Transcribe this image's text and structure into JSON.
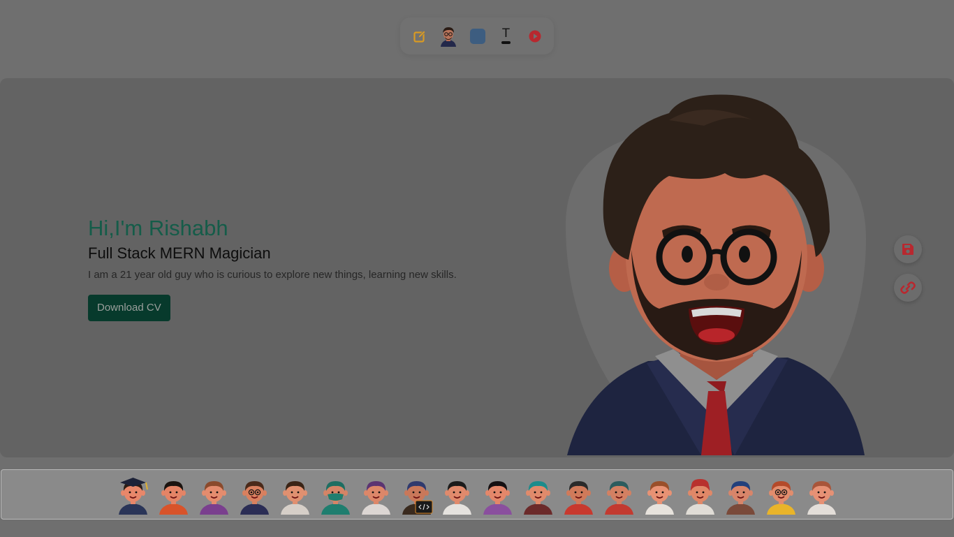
{
  "toolbar": {
    "items": [
      "edit-icon",
      "avatar-thumb",
      "color-swatch",
      "text-style",
      "play-icon"
    ],
    "text_glyph": "T",
    "swatch_color": "#3d5d80",
    "edit_color": "#d99a22",
    "play_color": "#b8282f"
  },
  "hero": {
    "greeting": "Hi,I'm Rishabh",
    "role": "Full Stack MERN Magician",
    "bio": "I am a 21 year old guy who is curious to explore new things, learning new skills.",
    "download_label": "Download CV",
    "accent_color": "#155c49",
    "button_color": "#073a2c"
  },
  "side_actions": [
    "save-icon",
    "link-icon"
  ],
  "avatar_strip": {
    "avatars": [
      {
        "name": "graduate",
        "skin": "#e8876a",
        "hair": "#2b1d15",
        "shirt": "#2a3558",
        "hat": "grad"
      },
      {
        "name": "girl-black-hair",
        "skin": "#e48466",
        "hair": "#1b1410",
        "shirt": "#d8532a"
      },
      {
        "name": "girl-brown-hair",
        "skin": "#e48c6e",
        "hair": "#8a4a2c",
        "shirt": "#7a3f8e"
      },
      {
        "name": "man-glasses-suit",
        "skin": "#d9805f",
        "hair": "#4a2a1a",
        "shirt": "#2b2d55",
        "glasses": true
      },
      {
        "name": "man-painter",
        "skin": "#e09070",
        "hair": "#3a2416",
        "shirt": "#d6cfc8"
      },
      {
        "name": "surgeon",
        "skin": "#d58466",
        "hair": "#1e6e62",
        "shirt": "#1f7e6f",
        "mask": true
      },
      {
        "name": "woman-hijab",
        "skin": "#dc8769",
        "hair": "#5b3472",
        "shirt": "#dcd6d3"
      },
      {
        "name": "developer",
        "skin": "#c9785a",
        "hair": "#2f3a6e",
        "shirt": "#3a2a1e",
        "laptop": true
      },
      {
        "name": "doctor",
        "skin": "#e08a6c",
        "hair": "#1b1b1b",
        "shirt": "#e5e2de"
      },
      {
        "name": "woman-purple",
        "skin": "#e4876a",
        "hair": "#151012",
        "shirt": "#8a4f9e"
      },
      {
        "name": "man-teal-hair",
        "skin": "#e08a6b",
        "hair": "#1c8c8c",
        "shirt": "#6b2a2a"
      },
      {
        "name": "man-beard",
        "skin": "#d07a5a",
        "hair": "#2a2a2a",
        "shirt": "#c8392e"
      },
      {
        "name": "man-headphones",
        "skin": "#d38062",
        "hair": "#2c5c5e",
        "shirt": "#c33a30"
      },
      {
        "name": "student-backpack",
        "skin": "#e89274",
        "hair": "#9a4f2a",
        "shirt": "#e7e2dc"
      },
      {
        "name": "man-red-cap",
        "skin": "#e08868",
        "hair": "#b8312e",
        "shirt": "#e0dcd6",
        "hat": "cap"
      },
      {
        "name": "man-scarf",
        "skin": "#d8856a",
        "hair": "#22407c",
        "shirt": "#7a4a3a"
      },
      {
        "name": "man-curly-glasses",
        "skin": "#e28d6d",
        "hair": "#b44a2a",
        "shirt": "#e9b42a",
        "glasses": true
      },
      {
        "name": "girl-backpack",
        "skin": "#e69175",
        "hair": "#a8553a",
        "shirt": "#e3ded9"
      }
    ]
  }
}
